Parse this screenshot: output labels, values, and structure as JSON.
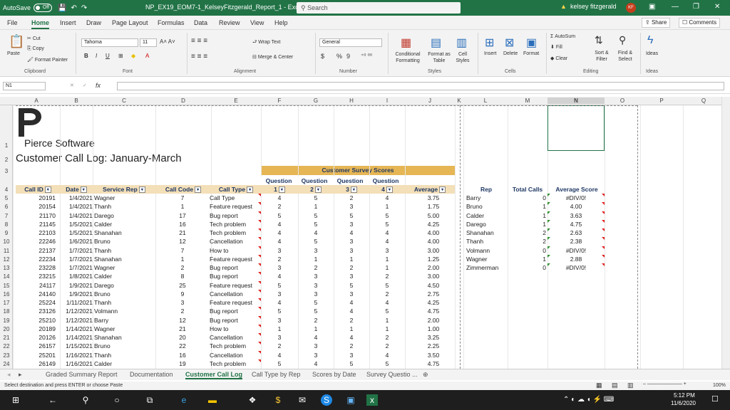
{
  "titlebar": {
    "autosave_label": "AutoSave",
    "autosave_state": "Off",
    "filename": "NP_EX19_EOM7-1_KelseyFitzgerald_Report_1",
    "app": "Excel",
    "search_placeholder": "Search",
    "user_name": "kelsey fitzgerald",
    "user_initials": "KF"
  },
  "tabs": [
    "File",
    "Home",
    "Insert",
    "Draw",
    "Page Layout",
    "Formulas",
    "Data",
    "Review",
    "View",
    "Help"
  ],
  "active_tab": "Home",
  "share_label": "Share",
  "comments_label": "Comments",
  "ribbon": {
    "clipboard": {
      "paste": "Paste",
      "cut": "Cut",
      "copy": "Copy",
      "format_painter": "Format Painter",
      "label": "Clipboard"
    },
    "font": {
      "name": "Tahoma",
      "size": "11",
      "label": "Font",
      "bold": "B",
      "italic": "I",
      "underline": "U"
    },
    "alignment": {
      "wrap": "Wrap Text",
      "merge": "Merge & Center",
      "label": "Alignment"
    },
    "number": {
      "format": "General",
      "currency": "$",
      "percent": "%",
      "comma": "9",
      "label": "Number"
    },
    "styles": {
      "conditional": "Conditional Formatting",
      "format_table": "Format as Table",
      "cell_styles": "Cell Styles",
      "label": "Styles"
    },
    "cells": {
      "insert": "Insert",
      "delete": "Delete",
      "format": "Format",
      "label": "Cells"
    },
    "editing": {
      "autosum": "AutoSum",
      "fill": "Fill",
      "clear": "Clear",
      "sort": "Sort & Filter",
      "find": "Find & Select",
      "label": "Editing"
    },
    "ideas": {
      "label": "Ideas"
    }
  },
  "formula_bar": {
    "name_box": "N1",
    "fx": "fx",
    "formula": ""
  },
  "columns": [
    "A",
    "B",
    "C",
    "D",
    "E",
    "F",
    "G",
    "H",
    "I",
    "J",
    "K",
    "L",
    "M",
    "N",
    "O",
    "P",
    "Q"
  ],
  "rows": [
    "1",
    "2",
    "3",
    "4",
    "5",
    "6",
    "7",
    "8",
    "9",
    "10",
    "11",
    "12",
    "13",
    "14",
    "15",
    "16",
    "17",
    "18",
    "19",
    "20",
    "21",
    "22",
    "23",
    "24"
  ],
  "sheet": {
    "company": "Pierce Software",
    "title": "Customer Call Log: January-March",
    "survey_header": "Customer Survey Scores",
    "question_label": "Question",
    "headers": [
      "Call ID",
      "Date",
      "Service Rep",
      "Call Code",
      "Call Type",
      "1",
      "2",
      "3",
      "4",
      "Average"
    ],
    "calls": [
      [
        "20191",
        "1/4/2021",
        "Wagner",
        "7",
        "Call Type",
        "4",
        "5",
        "2",
        "4",
        "3.75"
      ],
      [
        "20154",
        "1/4/2021",
        "Thanh",
        "1",
        "Feature request",
        "2",
        "1",
        "3",
        "1",
        "1.75"
      ],
      [
        "21170",
        "1/4/2021",
        "Darego",
        "17",
        "Bug report",
        "5",
        "5",
        "5",
        "5",
        "5.00"
      ],
      [
        "21145",
        "1/5/2021",
        "Calder",
        "16",
        "Tech problem",
        "4",
        "5",
        "3",
        "5",
        "4.25"
      ],
      [
        "22103",
        "1/5/2021",
        "Shanahan",
        "21",
        "Tech problem",
        "4",
        "4",
        "4",
        "4",
        "4.00"
      ],
      [
        "22246",
        "1/6/2021",
        "Bruno",
        "12",
        "Cancellation",
        "4",
        "5",
        "3",
        "4",
        "4.00"
      ],
      [
        "22137",
        "1/7/2021",
        "Thanh",
        "7",
        "How to",
        "3",
        "3",
        "3",
        "3",
        "3.00"
      ],
      [
        "22234",
        "1/7/2021",
        "Shanahan",
        "1",
        "Feature request",
        "2",
        "1",
        "1",
        "1",
        "1.25"
      ],
      [
        "23228",
        "1/7/2021",
        "Wagner",
        "2",
        "Bug report",
        "3",
        "2",
        "2",
        "1",
        "2.00"
      ],
      [
        "23215",
        "1/8/2021",
        "Calder",
        "8",
        "Bug report",
        "4",
        "3",
        "3",
        "2",
        "3.00"
      ],
      [
        "24117",
        "1/9/2021",
        "Darego",
        "25",
        "Feature request",
        "5",
        "3",
        "5",
        "5",
        "4.50"
      ],
      [
        "24140",
        "1/9/2021",
        "Bruno",
        "9",
        "Cancellation",
        "3",
        "3",
        "3",
        "2",
        "2.75"
      ],
      [
        "25224",
        "1/11/2021",
        "Thanh",
        "3",
        "Feature request",
        "4",
        "5",
        "4",
        "4",
        "4.25"
      ],
      [
        "23126",
        "1/12/2021",
        "Volmann",
        "2",
        "Bug report",
        "5",
        "5",
        "4",
        "5",
        "4.75"
      ],
      [
        "25210",
        "1/12/2021",
        "Barry",
        "12",
        "Bug report",
        "3",
        "2",
        "2",
        "1",
        "2.00"
      ],
      [
        "20189",
        "1/14/2021",
        "Wagner",
        "21",
        "How to",
        "1",
        "1",
        "1",
        "1",
        "1.00"
      ],
      [
        "20126",
        "1/14/2021",
        "Shanahan",
        "20",
        "Cancellation",
        "3",
        "4",
        "4",
        "2",
        "3.25"
      ],
      [
        "26157",
        "1/15/2021",
        "Bruno",
        "22",
        "Tech problem",
        "2",
        "3",
        "2",
        "2",
        "2.25"
      ],
      [
        "25201",
        "1/16/2021",
        "Thanh",
        "16",
        "Cancellation",
        "4",
        "3",
        "3",
        "4",
        "3.50"
      ],
      [
        "26149",
        "1/16/2021",
        "Calder",
        "19",
        "Tech problem",
        "5",
        "4",
        "5",
        "5",
        "4.75"
      ]
    ],
    "rep_headers": [
      "Rep",
      "Total Calls",
      "Average Score"
    ],
    "reps": [
      [
        "Barry",
        "0",
        "#DIV/0!"
      ],
      [
        "Bruno",
        "1",
        "4.00"
      ],
      [
        "Calder",
        "1",
        "3.63"
      ],
      [
        "Darego",
        "1",
        "4.75"
      ],
      [
        "Shanahan",
        "2",
        "2.63"
      ],
      [
        "Thanh",
        "2",
        "2.38"
      ],
      [
        "Volmann",
        "0",
        "#DIV/0!"
      ],
      [
        "Wagner",
        "1",
        "2.88"
      ],
      [
        "Zimmerman",
        "0",
        "#DIV/0!"
      ]
    ]
  },
  "sheet_tabs": [
    "Graded Summary Report",
    "Documentation",
    "Customer Call Log",
    "Call Type by Rep",
    "Scores by Date",
    "Survey Questio ..."
  ],
  "active_sheet": "Customer Call Log",
  "status": {
    "message": "Select destination and press ENTER or choose Paste",
    "zoom": "100%"
  },
  "taskbar": {
    "time": "5:12 PM",
    "date": "11/6/2020"
  }
}
